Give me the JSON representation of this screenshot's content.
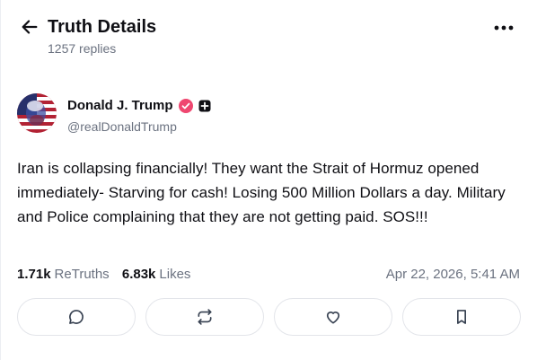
{
  "header": {
    "title": "Truth Details",
    "replies": "1257 replies"
  },
  "author": {
    "name": "Donald J. Trump",
    "handle": "@realDonaldTrump"
  },
  "post": {
    "text": "Iran is collapsing financially! They want the Strait of Hormuz opened immediately- Starving for cash! Losing 500 Million Dollars a day. Military and Police complaining that they are not getting paid. SOS!!!"
  },
  "stats": {
    "retruths_count": "1.71k",
    "retruths_label": "ReTruths",
    "likes_count": "6.83k",
    "likes_label": "Likes",
    "timestamp": "Apr 22, 2026, 5:41 AM"
  },
  "icons": {
    "back": "arrow-left-icon",
    "more": "more-horizontal-icon",
    "verified": "verified-badge-icon",
    "plus": "plus-badge-icon",
    "reply": "reply-icon",
    "retruth": "retruth-icon",
    "like": "heart-icon",
    "bookmark": "bookmark-icon"
  },
  "colors": {
    "verified": "#ef4770",
    "text": "#0f0f14",
    "muted": "#6b7280",
    "border": "#e3e5ea"
  }
}
